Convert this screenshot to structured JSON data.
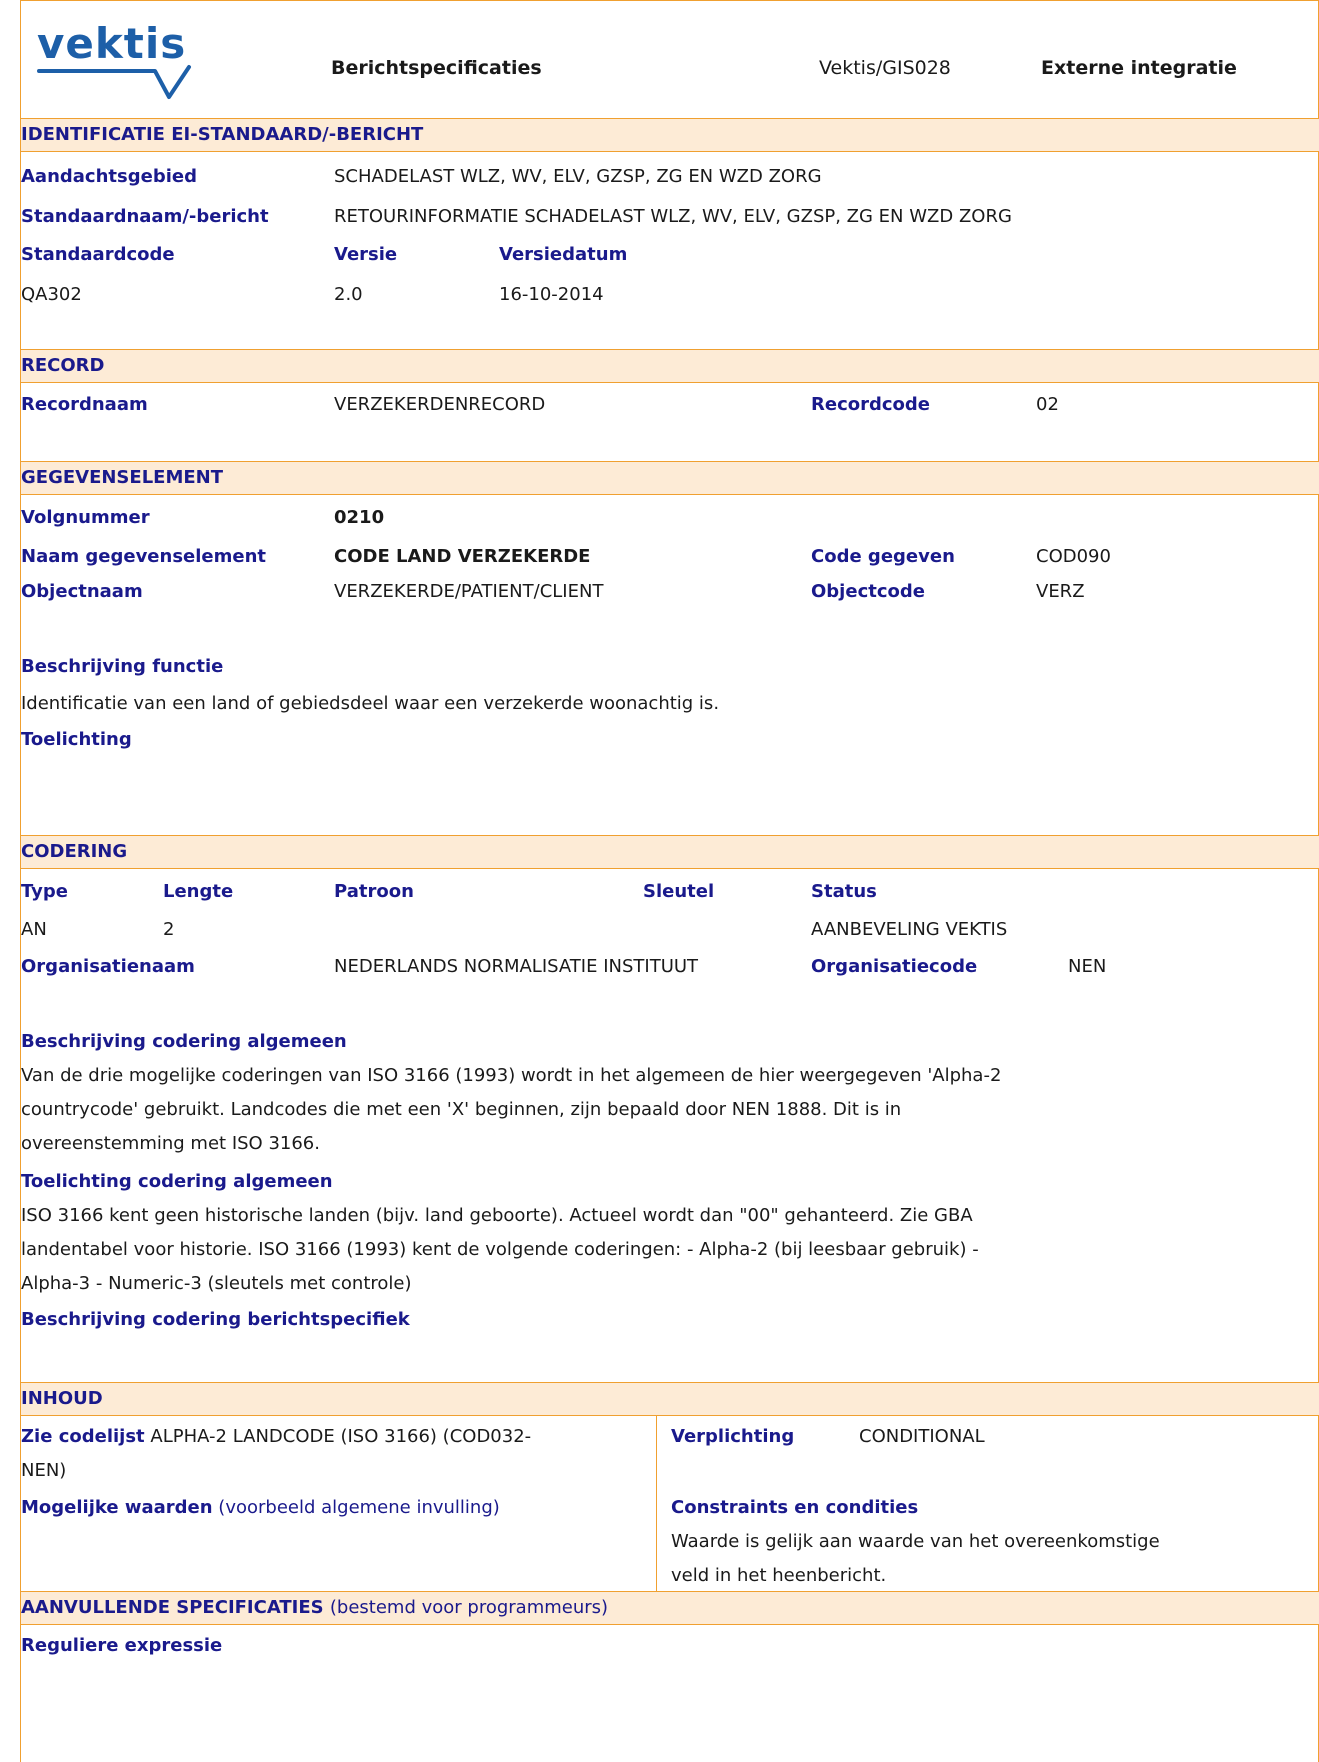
{
  "header": {
    "logo": "vektis",
    "title": "Berichtspecificaties",
    "code": "Vektis/GIS028",
    "scope": "Externe integratie"
  },
  "identificatie": {
    "heading": "IDENTIFICATIE EI-STANDAARD/-BERICHT",
    "aandachtsgebied_label": "Aandachtsgebied",
    "aandachtsgebied_value": "SCHADELAST WLZ, WV, ELV, GZSP, ZG EN WZD ZORG",
    "standaardnaam_label": "Standaardnaam/-bericht",
    "standaardnaam_value": "RETOURINFORMATIE SCHADELAST WLZ, WV, ELV, GZSP, ZG EN WZD ZORG",
    "standaardcode_label": "Standaardcode",
    "versie_label": "Versie",
    "versiedatum_label": "Versiedatum",
    "standaardcode_value": "QA302",
    "versie_value": "2.0",
    "versiedatum_value": "16-10-2014"
  },
  "record": {
    "heading": "RECORD",
    "recordnaam_label": "Recordnaam",
    "recordnaam_value": "VERZEKERDENRECORD",
    "recordcode_label": "Recordcode",
    "recordcode_value": "02"
  },
  "gegevenselement": {
    "heading": "GEGEVENSELEMENT",
    "volgnummer_label": "Volgnummer",
    "volgnummer_value": "0210",
    "naam_label": "Naam gegevenselement",
    "naam_value": "CODE LAND VERZEKERDE",
    "codegegeven_label": "Code gegeven",
    "codegegeven_value": "COD090",
    "objectnaam_label": "Objectnaam",
    "objectnaam_value": "VERZEKERDE/PATIENT/CLIENT",
    "objectcode_label": "Objectcode",
    "objectcode_value": "VERZ",
    "beschrijving_label": "Beschrijving functie",
    "beschrijving_value": "Identificatie van een land of gebiedsdeel waar een verzekerde woonachtig is.",
    "toelichting_label": "Toelichting"
  },
  "codering": {
    "heading": "CODERING",
    "type_label": "Type",
    "lengte_label": "Lengte",
    "patroon_label": "Patroon",
    "sleutel_label": "Sleutel",
    "status_label": "Status",
    "type_value": "AN",
    "lengte_value": "2",
    "status_value": "AANBEVELING VEKTIS",
    "organisatienaam_label": "Organisatienaam",
    "organisatienaam_value": "NEDERLANDS NORMALISATIE INSTITUUT",
    "organisatiecode_label": "Organisatiecode",
    "organisatiecode_value": "NEN",
    "beschrijving_label": "Beschrijving codering algemeen",
    "beschrijving_lines": [
      "Van de drie mogelijke coderingen van ISO 3166 (1993) wordt in het algemeen de hier weergegeven 'Alpha-2",
      "countrycode' gebruikt. Landcodes die met een 'X' beginnen, zijn bepaald door NEN 1888. Dit is in",
      "overeenstemming met ISO 3166."
    ],
    "toelichting_label": "Toelichting codering algemeen",
    "toelichting_lines": [
      "ISO 3166 kent geen historische landen (bijv. land geboorte). Actueel wordt dan \"00\" gehanteerd. Zie GBA",
      "landentabel voor historie. ISO 3166 (1993) kent de volgende coderingen: - Alpha-2 (bij leesbaar gebruik) -",
      "Alpha-3 - Numeric-3 (sleutels met controle)"
    ],
    "berichtspecifiek_label": "Beschrijving codering berichtspecifiek"
  },
  "inhoud": {
    "heading": "INHOUD",
    "codelijst_label": "Zie codelijst",
    "codelijst_value_line1": "ALPHA-2 LANDCODE (ISO 3166) (COD032-",
    "codelijst_value_line2": "NEN)",
    "verplichting_label": "Verplichting",
    "verplichting_value": "CONDITIONAL",
    "waarden_label": "Mogelijke waarden",
    "waarden_sub": "(voorbeeld algemene invulling)",
    "constraints_label": "Constraints en condities",
    "constraints_lines": [
      "Waarde is gelijk aan waarde van het overeenkomstige",
      "veld in het heenbericht."
    ]
  },
  "aanvullend": {
    "heading": "AANVULLENDE SPECIFICATIES",
    "heading_sub": "(bestemd voor programmeurs)",
    "regex_label": "Reguliere expressie"
  },
  "colors": {
    "border": "#f0a030",
    "section_bg": "#fdebd6",
    "label": "#1a1a8c",
    "logo": "#1d5fa8"
  }
}
